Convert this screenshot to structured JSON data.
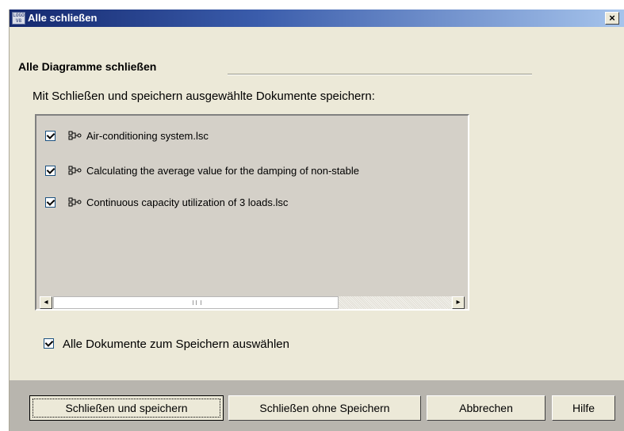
{
  "window": {
    "title": "Alle schließen",
    "app_icon_text": "LOGO\nV8",
    "close_glyph": "×"
  },
  "group": {
    "title": "Alle Diagramme schließen",
    "instruction": "Mit Schließen und speichern ausgewählte Dokumente speichern:"
  },
  "documents": [
    {
      "name": "Air-conditioning system.lsc",
      "checked": true
    },
    {
      "name": "Calculating the average value for the damping of non-stable",
      "checked": true
    },
    {
      "name": "Continuous capacity utilization of 3 loads.lsc",
      "checked": true
    }
  ],
  "scrollbar": {
    "left_arrow": "◂",
    "right_arrow": "▸"
  },
  "select_all": {
    "label": "Alle Dokumente zum Speichern auswählen",
    "checked": true
  },
  "buttons": {
    "close_save": "Schließen und speichern",
    "close_nosave": "Schließen ohne Speichern",
    "cancel": "Abbrechen",
    "help": "Hilfe"
  },
  "colors": {
    "titlebar_start": "#14286e",
    "titlebar_end": "#a6c4ec",
    "dialog_bg": "#ece9d8",
    "list_bg": "#d4d0c8",
    "button_bar": "#b8b5ae"
  }
}
